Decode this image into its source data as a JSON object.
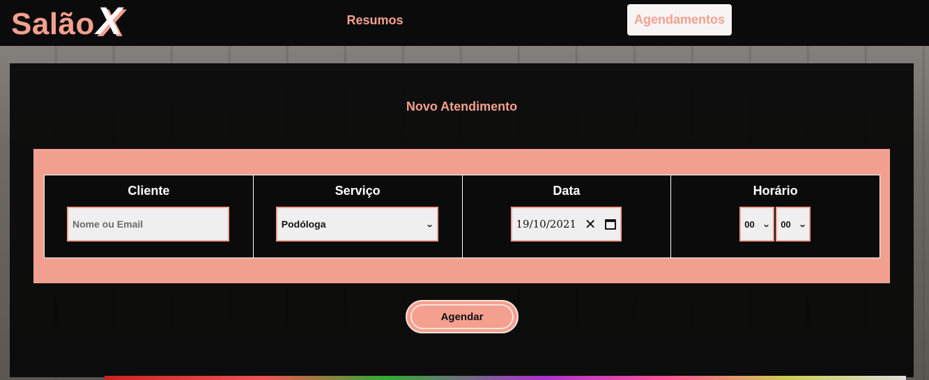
{
  "brand": {
    "name": "Salão",
    "mark": "X"
  },
  "nav": {
    "resumos": "Resumos",
    "agendamentos": "Agendamentos",
    "active": "agendamentos"
  },
  "form": {
    "title": "Novo Atendimento",
    "cliente": {
      "label": "Cliente",
      "placeholder": "Nome ou Email",
      "value": ""
    },
    "servico": {
      "label": "Serviço",
      "selected": "Podóloga"
    },
    "data": {
      "label": "Data",
      "value": "19/10/2021"
    },
    "horario": {
      "label": "Horário",
      "hour": "00",
      "minute": "00"
    },
    "submit": "Agendar"
  },
  "colors": {
    "accent": "#f4a08f",
    "panel": "#0b0b0b",
    "active_tab_bg": "#f7f5f4"
  },
  "icons": {
    "select_arrow": "chevron-down-icon",
    "clear": "close-icon",
    "calendar": "calendar-icon"
  }
}
